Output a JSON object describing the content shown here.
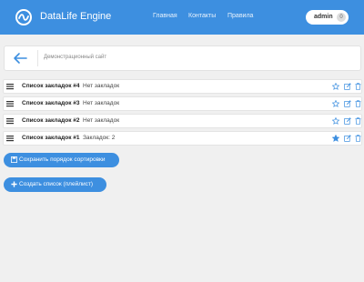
{
  "header": {
    "brand": "DataLife Engine",
    "nav": [
      "Главная",
      "Контакты",
      "Правила"
    ],
    "user": "admin",
    "badge": "0"
  },
  "topbar": {
    "breadcrumb": "Демонстрационный сайт"
  },
  "lists": [
    {
      "title": "Список закладок #4",
      "note": "Нет закладок",
      "starred": false
    },
    {
      "title": "Список закладок #3",
      "note": "Нет закладок",
      "starred": false
    },
    {
      "title": "Список закладок #2",
      "note": "Нет закладок",
      "starred": false
    },
    {
      "title": "Список закладок #1",
      "note": "Закладок: 2",
      "starred": true
    }
  ],
  "actions": {
    "save_order": "Сохранить порядок сортировки",
    "create_list": "Создать список (плейлист)"
  },
  "colors": {
    "accent": "#3d8fe0",
    "background": "#f0f0f0"
  }
}
